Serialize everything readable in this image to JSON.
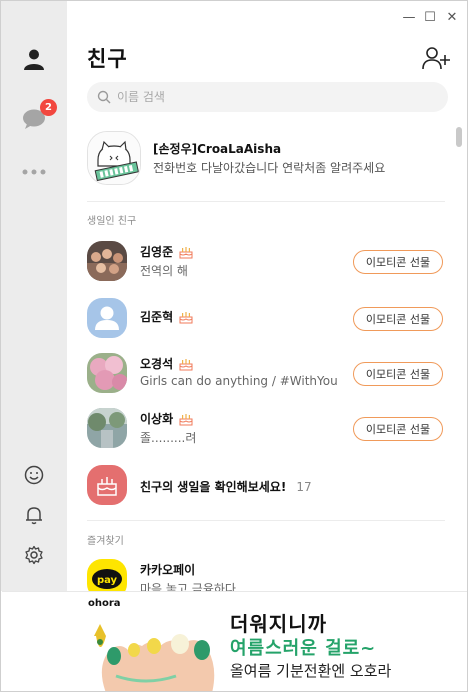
{
  "window_controls": {
    "minimize": "—",
    "maximize": "☐",
    "close": "✕"
  },
  "sidebar": {
    "chat_badge": "2"
  },
  "header": {
    "title": "친구"
  },
  "search": {
    "placeholder": "이름 검색"
  },
  "my_profile": {
    "name": "[손정우]CroaLaAisha",
    "status": "전화번호 다날아갔습니다 연락처좀 알려주세요"
  },
  "birthday_section": {
    "label": "생일인 친구",
    "gift_label": "이모티콘 선물",
    "friends": [
      {
        "name": "김영준",
        "status": "전역의 해"
      },
      {
        "name": "김준혁",
        "status": ""
      },
      {
        "name": "오경석",
        "status": "Girls can do anything / #WithYou"
      },
      {
        "name": "이상화",
        "status": "졸.........려"
      }
    ],
    "check_label": "친구의 생일을 확인해보세요!",
    "check_count": "17"
  },
  "favorites_section": {
    "label": "즐겨찾기",
    "items": [
      {
        "name": "카카오페이",
        "status": "마음 놓고 금융하다",
        "icon_text": "pay"
      }
    ]
  },
  "ad": {
    "brand": "ohora",
    "line1": "더워지니까",
    "line2": "여름스러운 걸로~",
    "line3": "올여름 기분전환엔 오호라"
  },
  "colors": {
    "accent_orange": "#f09a5a",
    "badge_red": "#f2473f",
    "kakao_yellow": "#fee500",
    "ad_green": "#25a36a"
  }
}
